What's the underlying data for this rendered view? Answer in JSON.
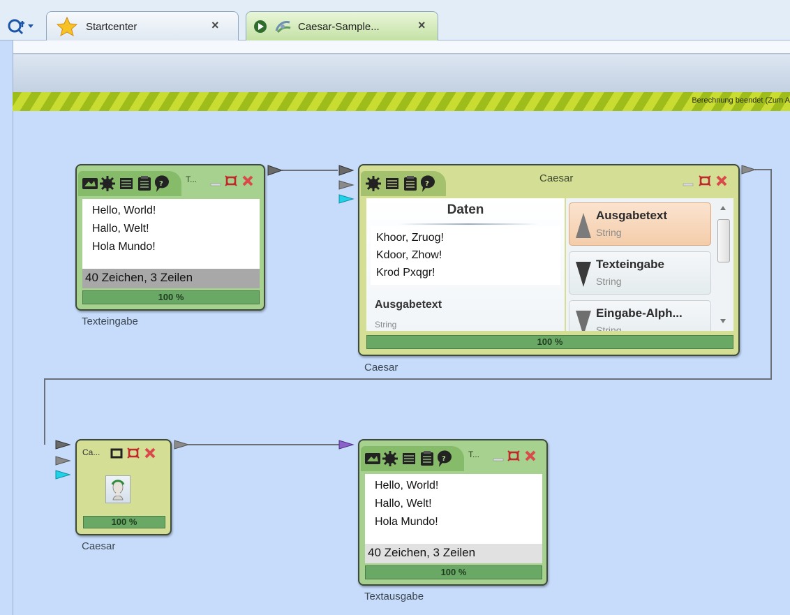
{
  "tabs": [
    {
      "label": "Startcenter",
      "icon": "star-icon",
      "close": "×",
      "active": false
    },
    {
      "label": "Caesar-Sample...",
      "icon": "caesar-workspace-icon",
      "close": "×",
      "active": true
    }
  ],
  "app_menu": {
    "icon": "cryptool-logo-icon",
    "arrow": "▾"
  },
  "status": {
    "text": "Berechnung beendet (Zum A"
  },
  "colors": {
    "canvas": "#c6dcfa",
    "plugin_green": "#a6d18e",
    "plugin_olive": "#d4de94",
    "progress": "#6aa865",
    "status_stripe": "#b6d024"
  },
  "plugins": {
    "text_input": {
      "title": "T...",
      "text_lines": [
        "Hello, World!",
        "Hallo, Welt!",
        "Hola Mundo!"
      ],
      "info": "40 Zeichen,  3 Zeilen",
      "progress": "100 %",
      "progress_value": 1.0,
      "caption": "Texteingabe"
    },
    "caesar_main": {
      "title": "Caesar",
      "data_title": "Daten",
      "data_lines": [
        "Khoor, Zruog!",
        "Kdoor, Zhow!",
        "Krod Pxqgr!"
      ],
      "output_label": "Ausgabetext",
      "output_type": "String",
      "connectors": [
        {
          "name": "Ausgabetext",
          "type": "String",
          "direction": "up",
          "selected": true
        },
        {
          "name": "Texteingabe",
          "type": "String",
          "direction": "down",
          "selected": false
        },
        {
          "name": "Eingabe-Alph...",
          "type": "String",
          "direction": "down",
          "selected": false
        }
      ],
      "progress": "100 %",
      "progress_value": 1.0,
      "caption": "Caesar"
    },
    "caesar_small": {
      "title": "Ca...",
      "progress": "100 %",
      "progress_value": 1.0,
      "caption": "Caesar"
    },
    "text_output": {
      "title": "T...",
      "text_lines": [
        "Hello, World!",
        "Hallo, Welt!",
        "Hola Mundo!"
      ],
      "info": "40 Zeichen,  3 Zeilen",
      "progress": "100 %",
      "progress_value": 1.0,
      "caption": "Textausgabe"
    }
  }
}
